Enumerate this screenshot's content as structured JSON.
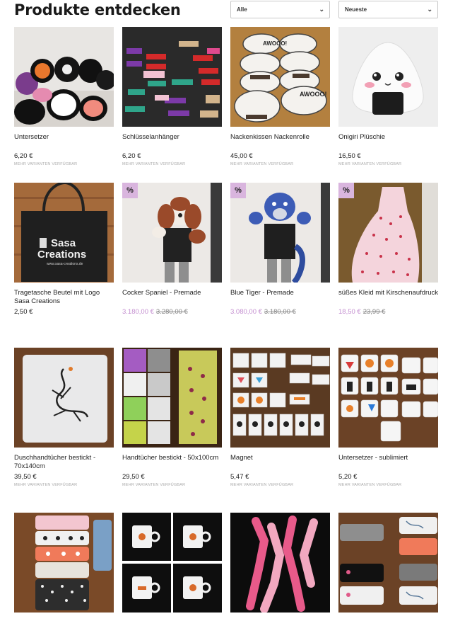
{
  "header": {
    "title": "Produkte entdecken",
    "filter_value": "Alle",
    "sort_value": "Neueste"
  },
  "products": [
    {
      "name": "Untersetzer",
      "price": "6,20 €",
      "variants": "MEHR VARIANTEN VERFÜGBAR"
    },
    {
      "name": "Schlüsselanhänger",
      "price": "6,20 €",
      "variants": "MEHR VARIANTEN VERFÜGBAR"
    },
    {
      "name": "Nackenkissen Nackenrolle",
      "price": "45,00 €",
      "variants": "MEHR VARIANTEN VERFÜGBAR"
    },
    {
      "name": "Onigiri Plüschie",
      "price": "16,50 €",
      "variants": "MEHR VARIANTEN VERFÜGBAR"
    },
    {
      "name": "Tragetasche Beutel mit Logo Sasa Creations",
      "price": "2,50 €",
      "bag_line1": "Sasa",
      "bag_line2": "Creations",
      "bag_url": "www.sasa-creations.de"
    },
    {
      "name": "Cocker Spaniel - Premade",
      "sale_price": "3.180,00 €",
      "old_price": "3.280,00 €",
      "badge": "%"
    },
    {
      "name": "Blue Tiger - Premade",
      "sale_price": "3.080,00 €",
      "old_price": "3.180,00 €",
      "badge": "%"
    },
    {
      "name": "süßes Kleid mit Kirschenaufdruck",
      "sale_price": "18,50 €",
      "old_price": "23,99 €",
      "badge": "%"
    },
    {
      "name": "Duschhandtücher bestickt - 70x140cm",
      "price": "39,50 €",
      "variants": "MEHR VARIANTEN VERFÜGBAR"
    },
    {
      "name": "Handtücher bestickt - 50x100cm",
      "price": "29,50 €",
      "variants": "MEHR VARIANTEN VERFÜGBAR"
    },
    {
      "name": "Magnet",
      "price": "5,47 €",
      "variants": "MEHR VARIANTEN VERFÜGBAR"
    },
    {
      "name": "Untersetzer - sublimiert",
      "price": "5,20 €",
      "variants": "MEHR VARIANTEN VERFÜGBAR"
    }
  ],
  "pillow_text": "AWOOO!"
}
